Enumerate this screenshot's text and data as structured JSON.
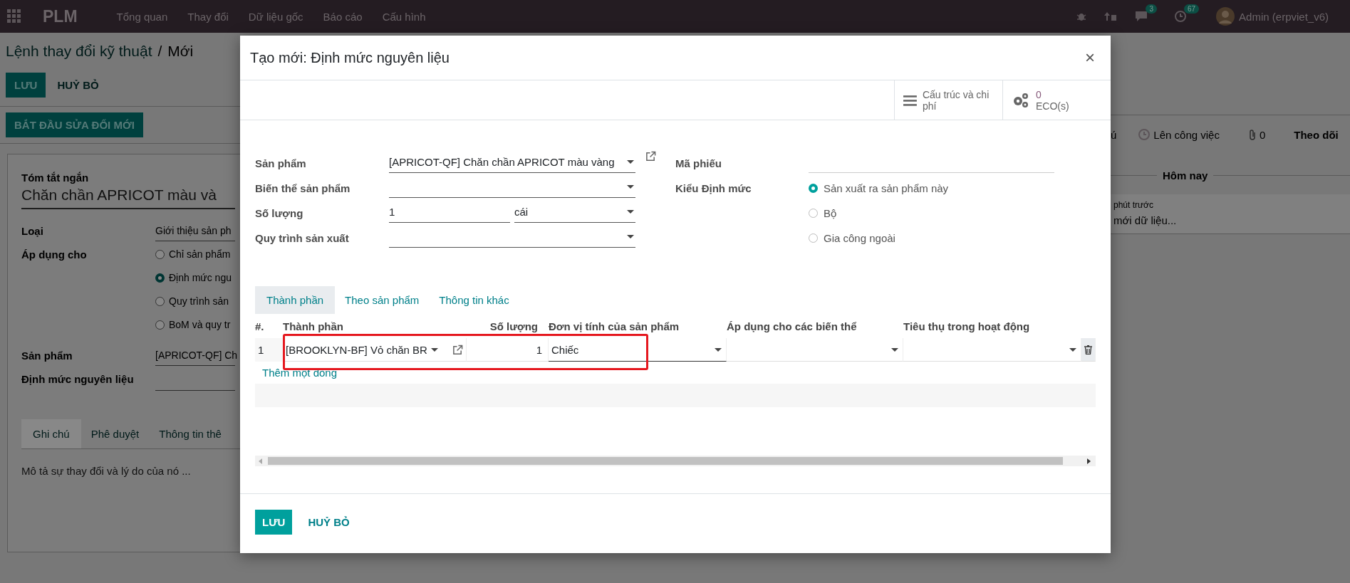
{
  "top_bar": {
    "app_name": "PLM",
    "menu": [
      "Tổng quan",
      "Thay đổi",
      "Dữ liệu gốc",
      "Báo cáo",
      "Cấu hình"
    ],
    "messages_badge": "3",
    "activities_badge": "67",
    "user": "Admin (erpviet_v6)"
  },
  "background_form": {
    "breadcrumb": [
      "Lệnh thay đổi kỹ thuật",
      "Mới"
    ],
    "breadcrumb_separator": "/",
    "buttons": [
      {
        "label": "LƯU",
        "kind": "primary"
      },
      {
        "label": "HUỶ BỎ",
        "kind": "link"
      }
    ],
    "action_button": "BẮT ĐẦU SỬA ĐỔI MỚI",
    "summary_label": "Tóm tắt ngắn",
    "summary_value": "Chăn chần APRICOT màu và",
    "type_label": "Loại",
    "type_value": "Giới thiệu sản ph",
    "apply_label": "Áp dụng cho",
    "apply_options": [
      {
        "label": "Chỉ sản phẩm",
        "selected": false
      },
      {
        "label": "Định mức ngu",
        "selected": true
      },
      {
        "label": "Quy trình sản",
        "selected": false
      },
      {
        "label": "BoM và quy tr",
        "selected": false
      }
    ],
    "product_label": "Sản phẩm",
    "product_value": "[APRICOT-QF] Ch",
    "bom_label": "Định mức nguyên liệu",
    "tabs": [
      {
        "label": "Ghi chú",
        "selected": true
      },
      {
        "label": "Phê duyệt",
        "selected": false
      },
      {
        "label": "Thông tin thê",
        "selected": false
      }
    ],
    "note_placeholder": "Mô tả sự thay đổi và lý do của nó ..."
  },
  "chatter": {
    "send_fragment": "ú",
    "schedule": "Lên công việc",
    "attachments": "0",
    "follow": "Theo dõi",
    "date_divider": "Hôm nay",
    "message_time": "phút trước",
    "message_text": "mới dữ liệu..."
  },
  "dialog": {
    "title": "Tạo mới: Định mức nguyên liệu",
    "close": "×",
    "stat_buttons": [
      {
        "kind": "list",
        "label": "Cấu trúc và chi phí"
      },
      {
        "kind": "gears",
        "value": "0",
        "label": "ECO(s)"
      }
    ],
    "fields_left": [
      {
        "label": "Sản phẩm",
        "kind": "select",
        "value": "[APRICOT-QF] Chăn chần APRICOT màu vàng",
        "external_link": true
      },
      {
        "label": "Biến thể sản phẩm",
        "kind": "select",
        "external_link": false
      },
      {
        "label": "Số lượng",
        "kind": "quantity",
        "value": "1",
        "unit": "cái"
      },
      {
        "label": "Quy trình sản xuất",
        "kind": "select",
        "external_link": false
      }
    ],
    "fields_right": [
      {
        "label": "Mã phiếu",
        "kind": "text"
      },
      {
        "label": "Kiểu Định mức",
        "kind": "radio",
        "options": [
          {
            "label": "Sản xuất ra sản phẩm này",
            "selected": true
          },
          {
            "label": "Bộ",
            "selected": false
          },
          {
            "label": "Gia công ngoài",
            "selected": false
          }
        ]
      }
    ],
    "tabs": [
      {
        "label": "Thành phần",
        "selected": true
      },
      {
        "label": "Theo sản phẩm",
        "selected": false
      },
      {
        "label": "Thông tin khác",
        "selected": false
      }
    ],
    "table": {
      "columns": [
        "#.",
        "Thành phần",
        "Số lượng",
        "Đơn vị tính của sản phẩm",
        "Áp dụng cho các biến thể",
        "Tiêu thụ trong hoạt động"
      ],
      "rows": [
        {
          "index": "1",
          "component": "[BROOKLYN-BF] Vỏ chăn BR",
          "quantity": "1",
          "unit": "Chiếc",
          "highlighted": true
        }
      ],
      "add_line": "Thêm một dòng"
    },
    "footer_buttons": [
      {
        "label": "LƯU",
        "kind": "primary"
      },
      {
        "label": "HUỶ BỎ",
        "kind": "link"
      }
    ]
  }
}
